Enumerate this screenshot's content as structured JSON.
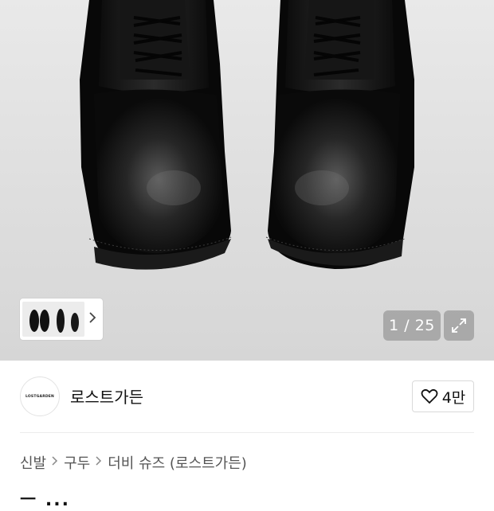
{
  "gallery": {
    "current": "1",
    "total": "25",
    "counter_text": "1 / 25",
    "thumbnail_strip_icon": "chevron-right-icon",
    "expand_icon": "expand-icon"
  },
  "brand": {
    "logo_text": "LOSTGARDEN",
    "name": "로스트가든",
    "like_icon": "heart-icon",
    "like_count": "4만"
  },
  "breadcrumb": {
    "items": [
      "신발",
      "구두",
      "더비 슈즈 (로스트가든)"
    ],
    "separator_icon": "chevron-right-icon"
  },
  "product": {
    "title_partial": "ㅡ ..."
  },
  "colors": {
    "background": "#ffffff",
    "hero_bg": "#e2e2e2",
    "overlay_button": "#8c8c8c",
    "text_primary": "#111111",
    "text_secondary": "#555555"
  }
}
